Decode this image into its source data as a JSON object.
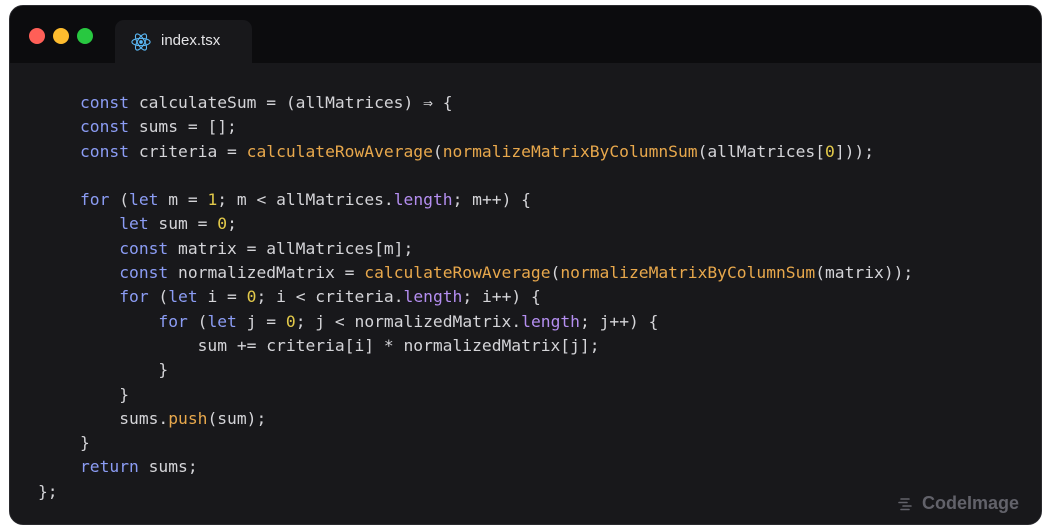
{
  "window": {
    "controls": {
      "close": "close-button",
      "minimize": "minimize-button",
      "zoom": "zoom-button"
    },
    "tab": {
      "label": "index.tsx",
      "icon": "react-icon"
    }
  },
  "editor": {
    "lines": [
      [
        {
          "t": "const ",
          "c": "kw"
        },
        {
          "t": "calculateSum = (allMatrices) ⇒ {",
          "c": "plain"
        }
      ],
      [
        {
          "t": "const ",
          "c": "kw"
        },
        {
          "t": "sums = [];",
          "c": "plain"
        }
      ],
      [
        {
          "t": "const ",
          "c": "kw"
        },
        {
          "t": "criteria = ",
          "c": "plain"
        },
        {
          "t": "calculateRowAverage",
          "c": "fn"
        },
        {
          "t": "(",
          "c": "plain"
        },
        {
          "t": "normalizeMatrixByColumnSum",
          "c": "fn"
        },
        {
          "t": "(allMatrices[",
          "c": "plain"
        },
        {
          "t": "0",
          "c": "num"
        },
        {
          "t": "]));",
          "c": "plain"
        }
      ],
      [],
      [
        {
          "t": "for ",
          "c": "kw"
        },
        {
          "t": "(",
          "c": "plain"
        },
        {
          "t": "let ",
          "c": "kw"
        },
        {
          "t": "m = ",
          "c": "plain"
        },
        {
          "t": "1",
          "c": "num"
        },
        {
          "t": "; m < allMatrices.",
          "c": "plain"
        },
        {
          "t": "length",
          "c": "prop"
        },
        {
          "t": "; m++) {",
          "c": "plain"
        }
      ],
      [
        {
          "t": "    let ",
          "c": "kw"
        },
        {
          "t": "sum = ",
          "c": "plain"
        },
        {
          "t": "0",
          "c": "num"
        },
        {
          "t": ";",
          "c": "plain"
        }
      ],
      [
        {
          "t": "    const ",
          "c": "kw"
        },
        {
          "t": "matrix = allMatrices[m];",
          "c": "plain"
        }
      ],
      [
        {
          "t": "    const ",
          "c": "kw"
        },
        {
          "t": "normalizedMatrix = ",
          "c": "plain"
        },
        {
          "t": "calculateRowAverage",
          "c": "fn"
        },
        {
          "t": "(",
          "c": "plain"
        },
        {
          "t": "normalizeMatrixByColumnSum",
          "c": "fn"
        },
        {
          "t": "(matrix));",
          "c": "plain"
        }
      ],
      [
        {
          "t": "    for ",
          "c": "kw"
        },
        {
          "t": "(",
          "c": "plain"
        },
        {
          "t": "let ",
          "c": "kw"
        },
        {
          "t": "i = ",
          "c": "plain"
        },
        {
          "t": "0",
          "c": "num"
        },
        {
          "t": "; i < criteria.",
          "c": "plain"
        },
        {
          "t": "length",
          "c": "prop"
        },
        {
          "t": "; i++) {",
          "c": "plain"
        }
      ],
      [
        {
          "t": "        for ",
          "c": "kw"
        },
        {
          "t": "(",
          "c": "plain"
        },
        {
          "t": "let ",
          "c": "kw"
        },
        {
          "t": "j = ",
          "c": "plain"
        },
        {
          "t": "0",
          "c": "num"
        },
        {
          "t": "; j < normalizedMatrix.",
          "c": "plain"
        },
        {
          "t": "length",
          "c": "prop"
        },
        {
          "t": "; j++) {",
          "c": "plain"
        }
      ],
      [
        {
          "t": "            sum += criteria[i] * normalizedMatrix[j];",
          "c": "plain"
        }
      ],
      [
        {
          "t": "        }",
          "c": "plain"
        }
      ],
      [
        {
          "t": "    }",
          "c": "plain"
        }
      ],
      [
        {
          "t": "    sums.",
          "c": "plain"
        },
        {
          "t": "push",
          "c": "fn"
        },
        {
          "t": "(sum);",
          "c": "plain"
        }
      ],
      [
        {
          "t": "}",
          "c": "plain"
        }
      ],
      [
        {
          "t": "return ",
          "c": "kw"
        },
        {
          "t": "sums;",
          "c": "plain"
        }
      ],
      [
        {
          "t": "};",
          "c": "plain"
        }
      ]
    ],
    "indents": [
      0,
      0,
      0,
      0,
      0,
      0,
      0,
      0,
      0,
      0,
      0,
      0,
      0,
      0,
      0,
      0,
      -1
    ]
  },
  "brand": {
    "label": "CodeImage",
    "icon": "codeimage-logo-icon"
  },
  "colors": {
    "keyword": "#8b9cf4",
    "function": "#e8a84c",
    "number": "#e2c94a",
    "property": "#b48ef0",
    "text": "#d4d4d8",
    "background": "#18181b"
  }
}
